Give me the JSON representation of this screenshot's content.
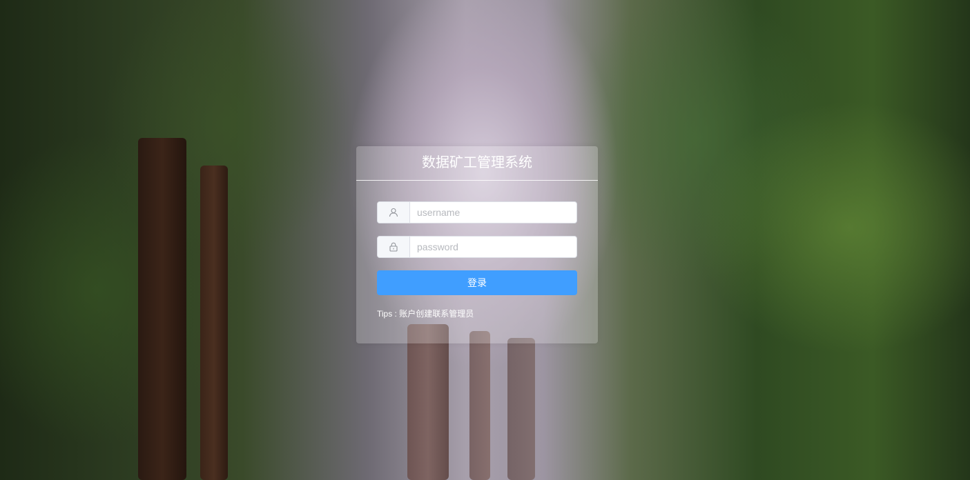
{
  "login": {
    "title": "数据矿工管理系统",
    "username_placeholder": "username",
    "password_placeholder": "password",
    "submit_label": "登录",
    "tips": "Tips : 账户创建联系管理员"
  },
  "icons": {
    "username": "user-icon",
    "password": "lock-icon"
  },
  "colors": {
    "primary": "#409eff",
    "card_overlay": "rgba(255,255,255,0.22)"
  }
}
